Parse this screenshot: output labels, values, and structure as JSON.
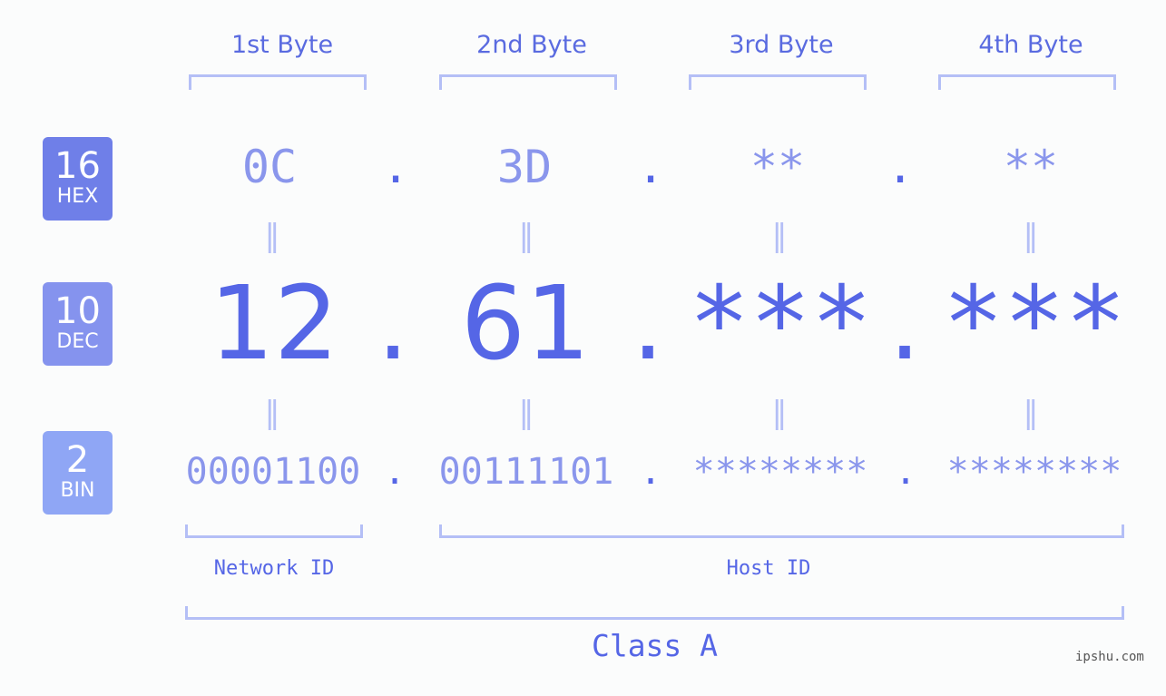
{
  "headers": [
    "1st Byte",
    "2nd Byte",
    "3rd Byte",
    "4th Byte"
  ],
  "badges": {
    "hex": {
      "num": "16",
      "label": "HEX",
      "color": "#6f7fe8"
    },
    "dec": {
      "num": "10",
      "label": "DEC",
      "color": "#8593ee"
    },
    "bin": {
      "num": "2",
      "label": "BIN",
      "color": "#8fa6f5"
    }
  },
  "hex": [
    "0C",
    "3D",
    "**",
    "**"
  ],
  "dec": [
    "12",
    "61",
    "***",
    "***"
  ],
  "bin": [
    "00001100",
    "00111101",
    "********",
    "********"
  ],
  "separator": ".",
  "equals": "=",
  "network_id_label": "Network ID",
  "host_id_label": "Host ID",
  "class_label": "Class A",
  "watermark": "ipshu.com"
}
